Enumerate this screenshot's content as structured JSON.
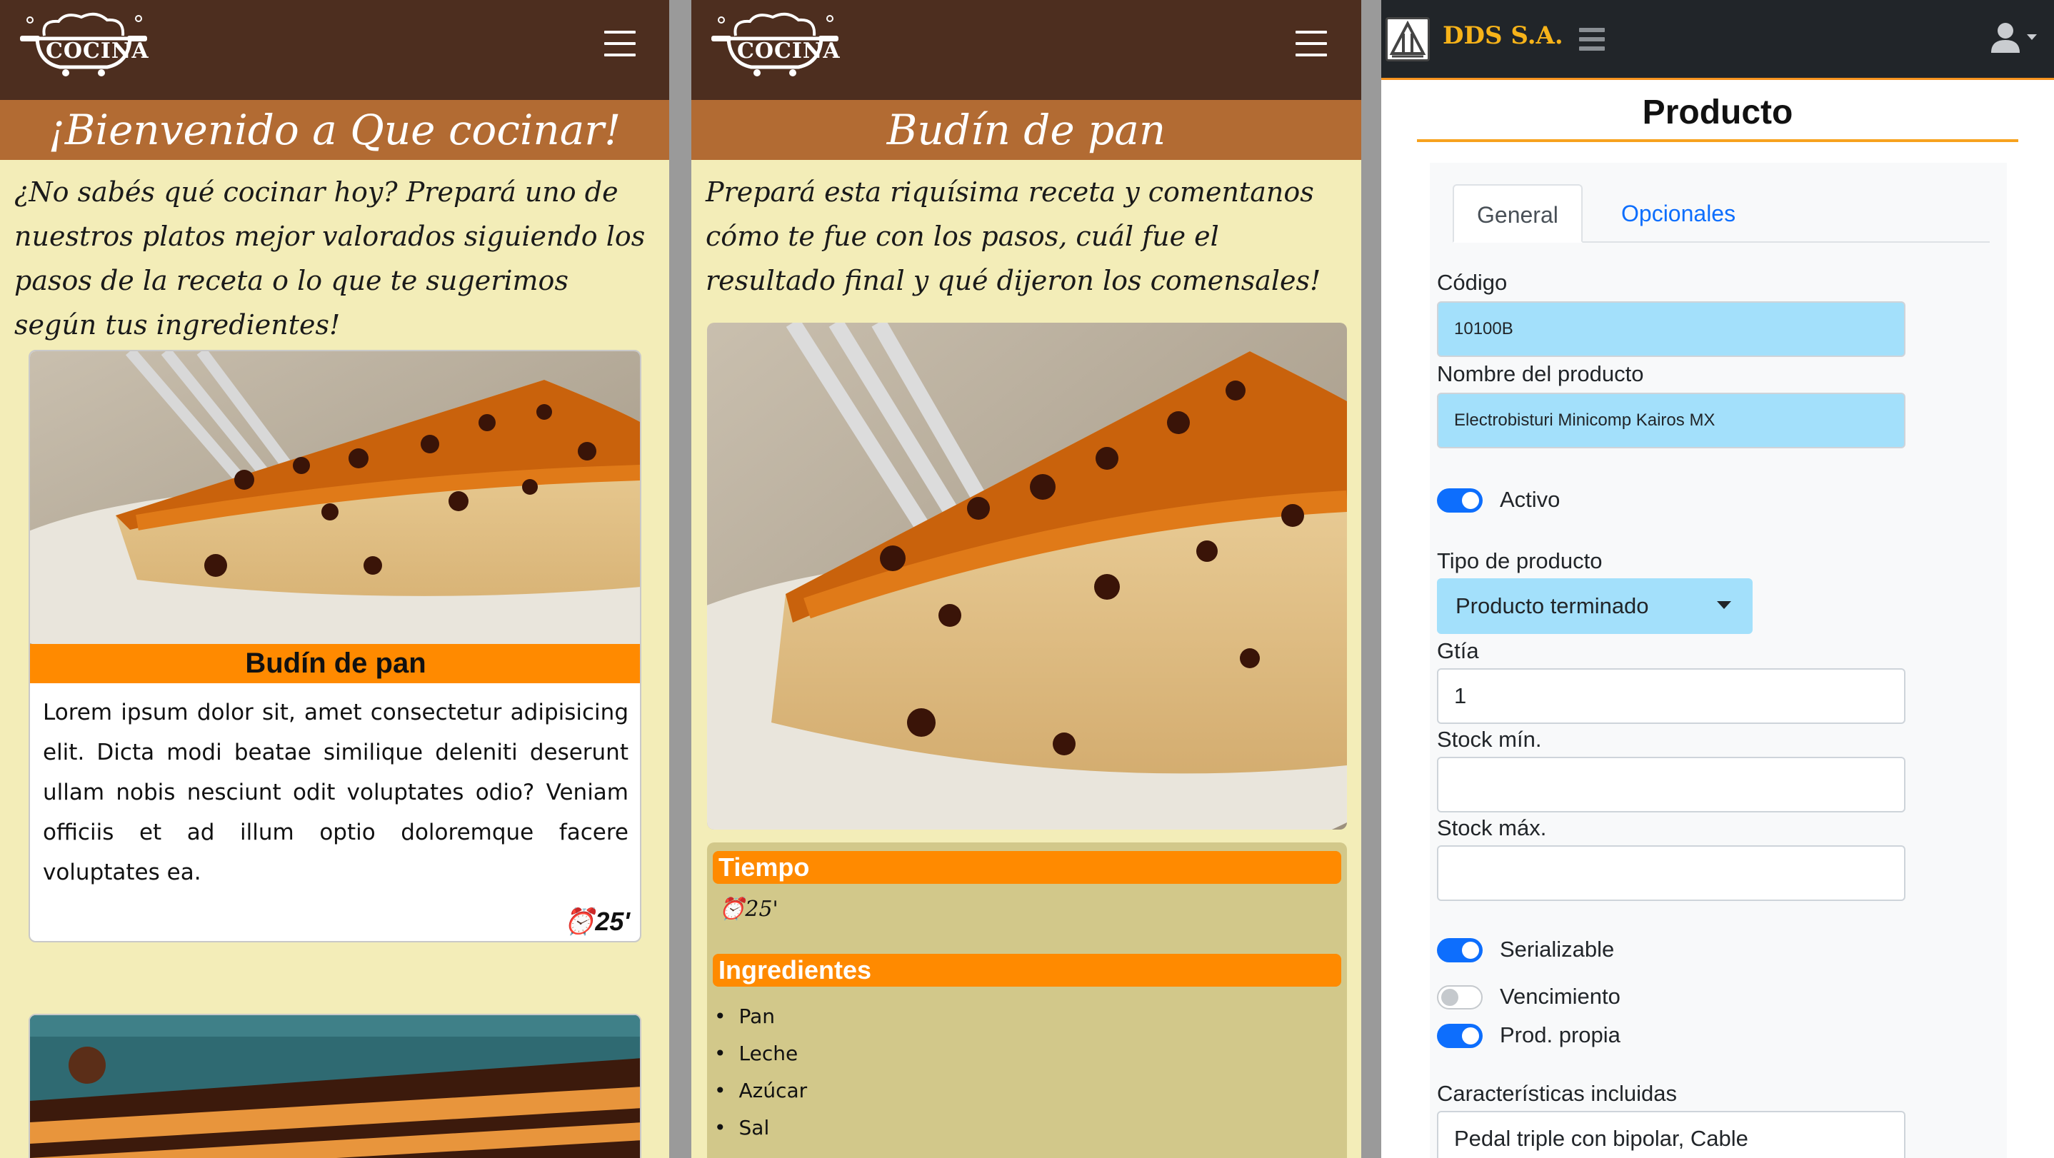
{
  "home": {
    "logo_text": "COCINA",
    "title": "¡Bienvenido a Que cocinar!",
    "intro": "¿No sabés qué cocinar hoy? Prepará uno de nuestros platos mejor valorados siguiendo los pasos de la receta o lo que te sugerimos según tus ingredientes!",
    "card": {
      "title": "Budín de pan",
      "text": "Lorem ipsum dolor sit, amet consectetur adipisicing elit. Dicta modi beatae similique deleniti deserunt ullam nobis nesciunt odit voluptates odio? Veniam officiis et ad illum optio doloremque facere voluptates ea.",
      "time": "25'"
    }
  },
  "recipe": {
    "logo_text": "COCINA",
    "title": "Budín de pan",
    "intro": "Prepará esta riquísima receta y comentanos cómo te fue con los pasos, cuál fue el resultado final y qué dijeron los comensales!",
    "time_label": "Tiempo",
    "time_value": "25'",
    "ingredients_label": "Ingredientes",
    "ingredients": [
      "Pan",
      "Leche",
      "Azúcar",
      "Sal"
    ]
  },
  "admin": {
    "brand": "DDS S.A.",
    "page_title": "Producto",
    "tabs": [
      "General",
      "Opcionales"
    ],
    "fields": {
      "codigo_label": "Código",
      "codigo_value": "10100B",
      "nombre_label": "Nombre del producto",
      "nombre_value": "Electrobisturi Minicomp Kairos MX",
      "activo_label": "Activo",
      "tipo_label": "Tipo de producto",
      "tipo_value": "Producto terminado",
      "gtia_label": "Gtía",
      "gtia_value": "1",
      "stock_min_label": "Stock mín.",
      "stock_max_label": "Stock máx.",
      "serializable_label": "Serializable",
      "vencimiento_label": "Vencimiento",
      "prod_propia_label": "Prod. propia",
      "caracteristicas_label": "Características incluidas",
      "caracteristicas_value": "Pedal triple con bipolar, Cable"
    },
    "toggles": {
      "activo": true,
      "serializable": true,
      "vencimiento": false,
      "prod_propia": true
    }
  },
  "colors": {
    "header_brown": "#4d2e1f",
    "title_bar": "#b26b33",
    "cream": "#f3edb8",
    "orange": "#ff8a00",
    "admin_accent": "#f7931e",
    "input_blue": "#a3e0fb",
    "toggle_blue": "#0d6efd"
  }
}
